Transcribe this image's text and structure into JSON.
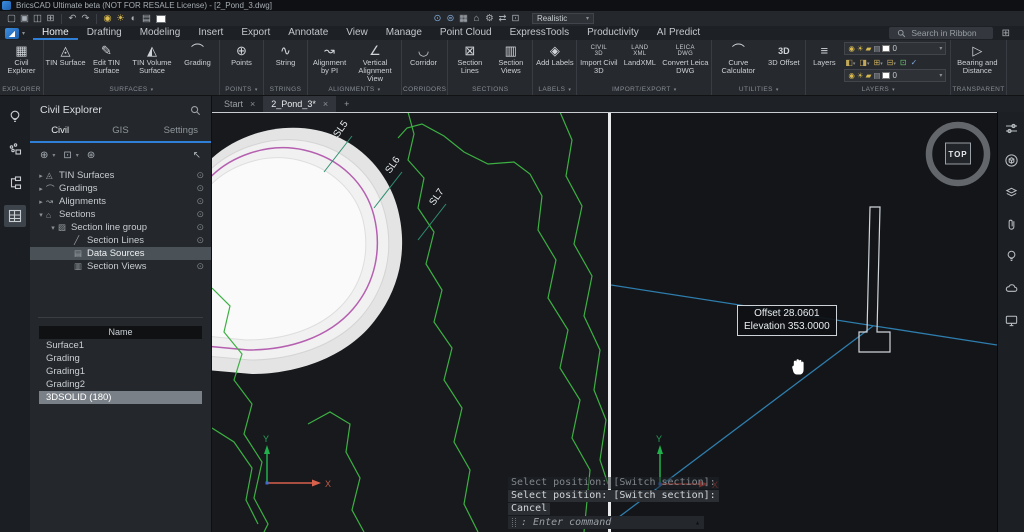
{
  "titlebar": {
    "title": "BricsCAD Ultimate beta (NOT FOR RESALE License) - [2_Pond_3.dwg]"
  },
  "qat": {
    "left": [
      "▢",
      "▣",
      "◫",
      "⊞",
      "↶",
      "↷",
      "◉",
      "☀",
      "◐",
      "▤"
    ],
    "mid": [
      "⊙",
      "⊜",
      "▦",
      "⌂",
      "⚙",
      "⇄",
      "⊡"
    ],
    "view_style": "Realistic"
  },
  "menu": {
    "items": [
      "Home",
      "Drafting",
      "Modeling",
      "Insert",
      "Export",
      "Annotate",
      "View",
      "Manage",
      "Point Cloud",
      "ExpressTools",
      "Productivity",
      "AI Predict"
    ],
    "search": "Search in Ribbon"
  },
  "ribbon": {
    "groups": [
      {
        "label": "EXPLORER",
        "buttons": [
          {
            "label": "Civil Explorer",
            "icon": "▦"
          }
        ]
      },
      {
        "label": "SURFACES",
        "buttons": [
          {
            "label": "TIN Surface",
            "icon": "◬"
          },
          {
            "label": "Edit TIN Surface",
            "icon": "✎"
          },
          {
            "label": "TIN Volume Surface",
            "icon": "◭"
          },
          {
            "label": "Grading",
            "icon": "⌒"
          }
        ]
      },
      {
        "label": "POINTS",
        "buttons": [
          {
            "label": "Points",
            "icon": "⊕"
          }
        ]
      },
      {
        "label": "STRINGS",
        "buttons": [
          {
            "label": "String",
            "icon": "∿"
          }
        ]
      },
      {
        "label": "ALIGNMENTS",
        "buttons": [
          {
            "label": "Alignment by PI",
            "icon": "↝"
          },
          {
            "label": "Vertical Alignment View",
            "icon": "∠"
          }
        ]
      },
      {
        "label": "CORRIDORS",
        "buttons": [
          {
            "label": "Corridor",
            "icon": "◡"
          }
        ]
      },
      {
        "label": "SECTIONS",
        "buttons": [
          {
            "label": "Section Lines",
            "icon": "⊠"
          },
          {
            "label": "Section Views",
            "icon": "▥"
          }
        ]
      },
      {
        "label": "LABELS",
        "buttons": [
          {
            "label": "Add Labels",
            "icon": "◈"
          }
        ]
      },
      {
        "label": "IMPORT/EXPORT",
        "buttons": [
          {
            "label": "Import Civil 3D",
            "icon": "CIVIL\n3D"
          },
          {
            "label": "LandXML",
            "icon": "LAND\nXML"
          },
          {
            "label": "Convert Leica DWG",
            "icon": "LEICA\nDWG"
          }
        ]
      },
      {
        "label": "UTILITIES",
        "buttons": [
          {
            "label": "Curve Calculator",
            "icon": "⌒"
          },
          {
            "label": "3D Offset",
            "icon": "3D"
          }
        ]
      },
      {
        "label": "LAYERS",
        "buttons": [
          {
            "label": "Layers",
            "icon": "≡"
          }
        ]
      },
      {
        "label": "TRANSPARENT",
        "buttons": [
          {
            "label": "Bearing and Distance",
            "icon": "▷"
          }
        ]
      }
    ],
    "layers": {
      "combo_icons": [
        "◉",
        "☀",
        "▰",
        "▤"
      ],
      "combo_value": "0",
      "tools": [
        "◧",
        "◨",
        "⊞",
        "⊟",
        "⊡",
        "✓"
      ]
    }
  },
  "doctabs": {
    "tabs": [
      "Start",
      "2_Pond_3*"
    ],
    "close": "×",
    "add": "+"
  },
  "panel": {
    "title": "Civil Explorer",
    "tabs": [
      "Civil",
      "GIS",
      "Settings"
    ],
    "tools": [
      "⊕",
      "⊡",
      "⊛"
    ],
    "cursor": "↖",
    "eye": "⊙",
    "tree": [
      {
        "arrow": "▸",
        "icon": "◬",
        "label": "TIN Surfaces"
      },
      {
        "arrow": "▸",
        "icon": "⌒",
        "label": "Gradings"
      },
      {
        "arrow": "▸",
        "icon": "↝",
        "label": "Alignments"
      },
      {
        "arrow": "▾",
        "icon": "⌂",
        "label": "Sections"
      },
      {
        "arrow": "▾",
        "icon": "▨",
        "label": "Section line group"
      },
      {
        "arrow": "",
        "icon": "╱",
        "label": "Section Lines"
      },
      {
        "arrow": "",
        "icon": "▤",
        "label": "Data Sources"
      },
      {
        "arrow": "",
        "icon": "▥",
        "label": "Section Views"
      }
    ],
    "names": {
      "header": "Name",
      "rows": [
        "Surface1",
        "Grading",
        "Grading1",
        "Grading2",
        "3DSOLID (180)"
      ]
    }
  },
  "vp": {
    "sl": [
      "SL5",
      "SL6",
      "SL7"
    ],
    "axis_x": "X",
    "axis_y": "Y",
    "viewcube": "TOP",
    "tooltip": {
      "l1": "Offset 28.0601",
      "l2": "Elevation 353.0000"
    }
  },
  "cmd": {
    "ghost": "Select position: [Switch section]:",
    "prompt": "Select position: [Switch section]:",
    "cancel": "Cancel",
    "input": ": Enter command",
    "caret": "▴"
  },
  "colors": {
    "accent": "#2f7fd6",
    "contour_green": "#3cb043",
    "pond_magenta": "#b55fb0",
    "section_blue": "#2e7dad"
  }
}
